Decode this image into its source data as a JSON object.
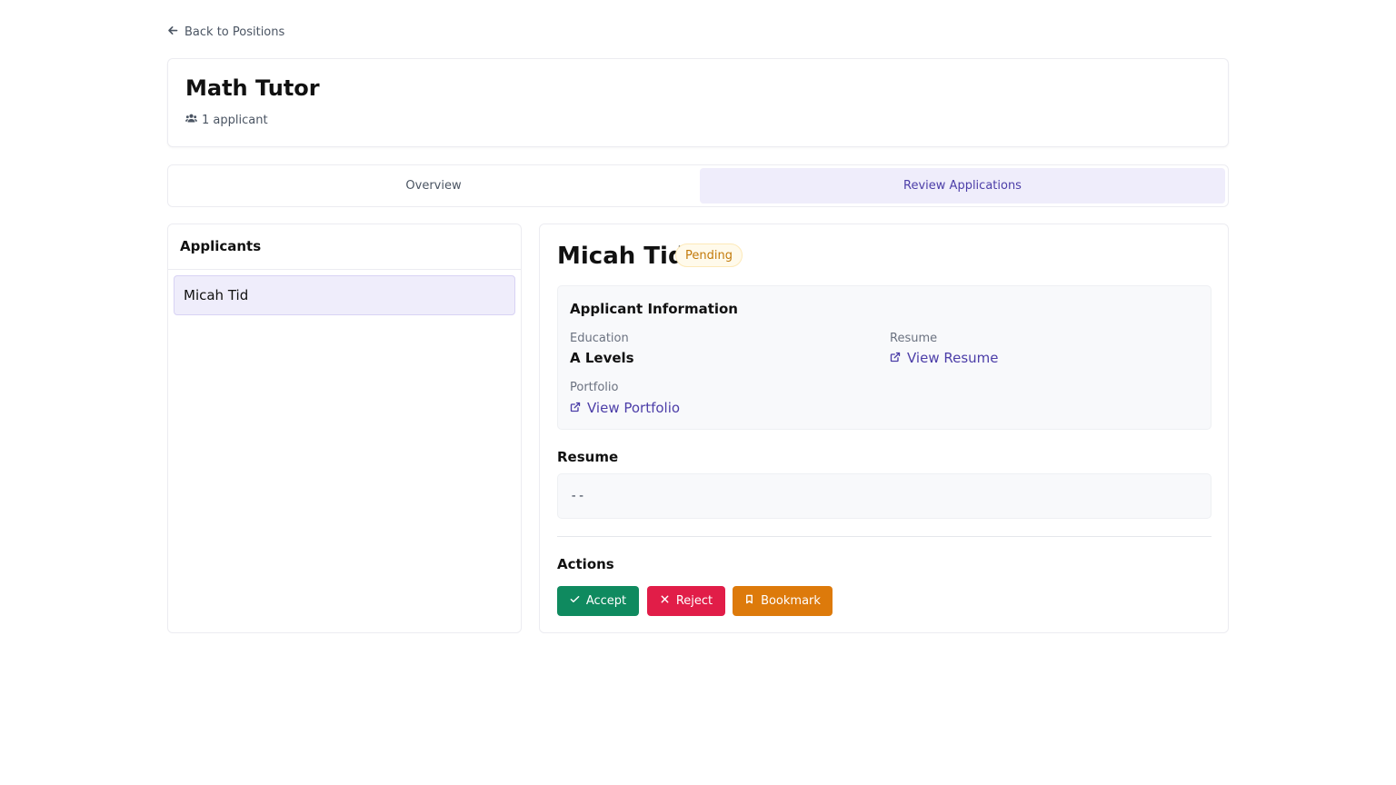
{
  "nav": {
    "back_label": "Back to Positions"
  },
  "position": {
    "title": "Math Tutor",
    "applicant_count": "1 applicant"
  },
  "tabs": [
    {
      "label": "Overview",
      "active": false
    },
    {
      "label": "Review Applications",
      "active": true
    }
  ],
  "applicants_panel": {
    "title": "Applicants",
    "items": [
      {
        "name": "Micah Tid",
        "selected": true
      }
    ]
  },
  "applicant": {
    "name": "Micah Tid",
    "status": "Pending",
    "info": {
      "title": "Applicant Information",
      "education_label": "Education",
      "education_value": "A Levels",
      "resume_label": "Resume",
      "resume_link": "View Resume",
      "portfolio_label": "Portfolio",
      "portfolio_link": "View Portfolio"
    },
    "resume_section": {
      "title": "Resume",
      "content": "--"
    },
    "actions": {
      "title": "Actions",
      "accept": "Accept",
      "reject": "Reject",
      "bookmark": "Bookmark"
    }
  },
  "colors": {
    "primary": "#4c3ea8",
    "active_tab_bg": "#efedfb",
    "pending": "#c27a0a",
    "accept": "#0f8a5f",
    "reject": "#e11d48",
    "bookmark": "#dd7a0b"
  },
  "icons": {
    "back": "arrow-left-icon",
    "applicants": "users-icon",
    "link": "external-link-icon",
    "accept": "check-icon",
    "reject": "x-icon",
    "bookmark": "bookmark-icon"
  }
}
